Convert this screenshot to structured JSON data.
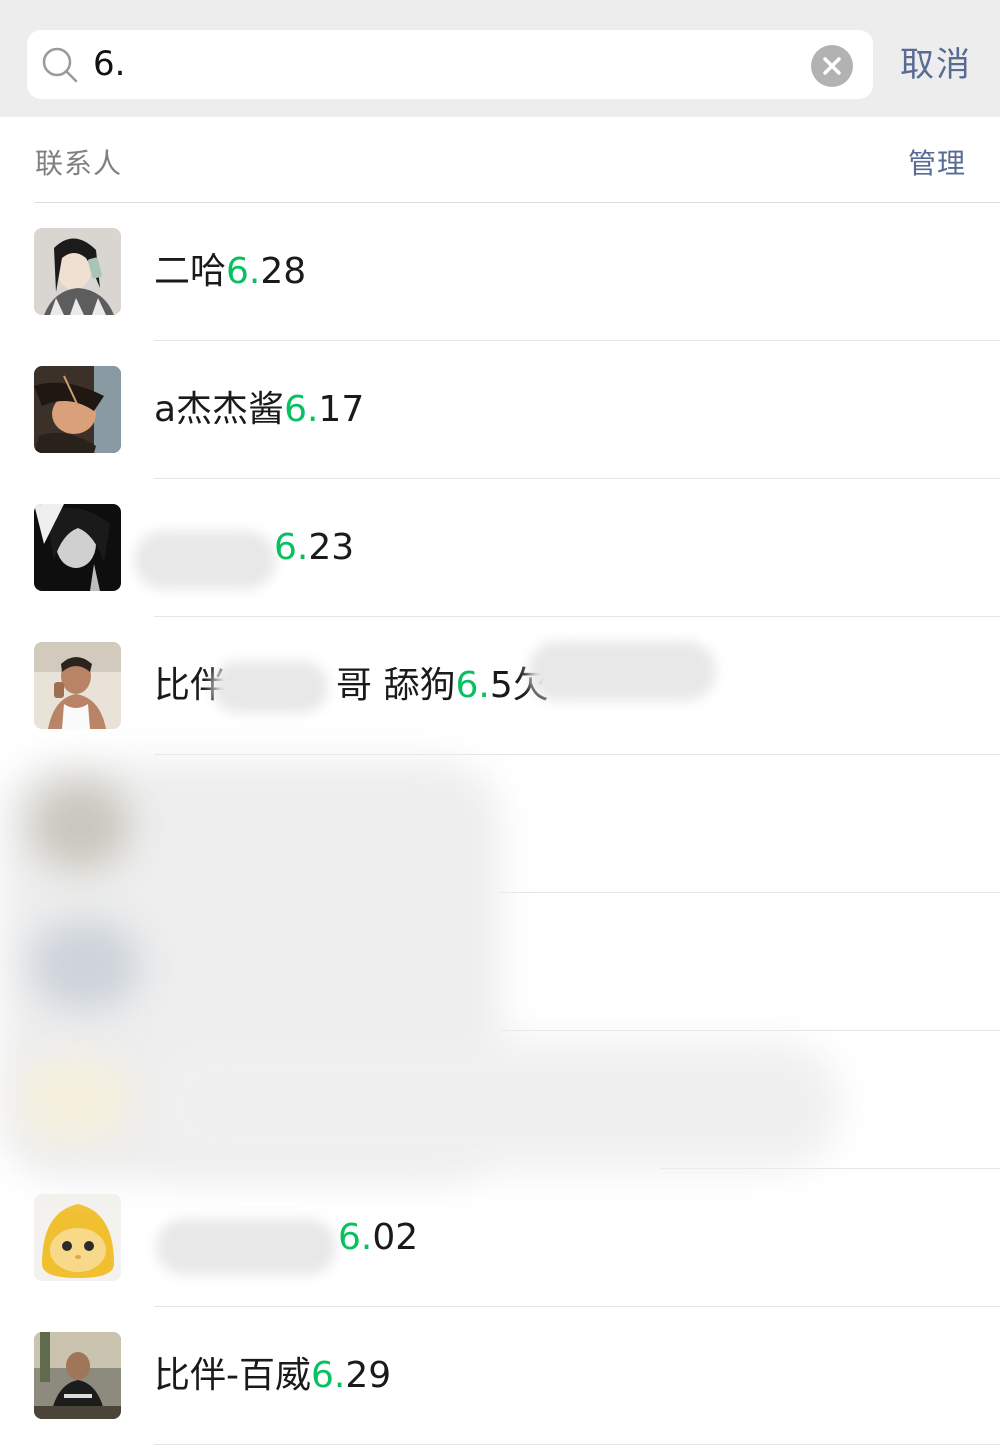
{
  "search": {
    "query": "6.",
    "cancel_label": "取消"
  },
  "section": {
    "title": "联系人",
    "manage_label": "管理"
  },
  "contacts": [
    {
      "prefix": "二哈",
      "highlight": "6.",
      "suffix": "28"
    },
    {
      "prefix": "a杰杰酱",
      "highlight": "6.",
      "suffix": "17"
    },
    {
      "prefix": "",
      "highlight": "6.",
      "suffix": "23"
    },
    {
      "prefix": "比伴",
      "middle": "哥 舔狗",
      "highlight": "6.",
      "suffix": "5欠"
    },
    {
      "prefix": "",
      "highlight": "",
      "suffix": ""
    },
    {
      "prefix": "",
      "highlight": "",
      "suffix": ""
    },
    {
      "prefix": "",
      "highlight": "",
      "suffix": ""
    },
    {
      "prefix": "",
      "highlight": "6.",
      "suffix": "02"
    },
    {
      "prefix": "比伴-百威",
      "highlight": "6.",
      "suffix": "29"
    }
  ],
  "colors": {
    "highlight": "#07c160",
    "link": "#576b95",
    "header_bg": "#ededed"
  }
}
